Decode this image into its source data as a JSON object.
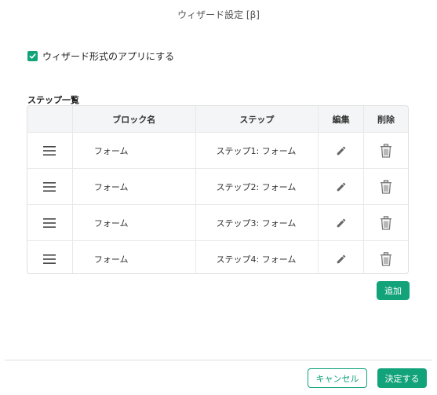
{
  "dialog": {
    "title": "ウィザード設定 [β]"
  },
  "wizard_checkbox": {
    "label": "ウィザード形式のアプリにする",
    "checked": true
  },
  "steps_section": {
    "label": "ステップ一覧",
    "columns": [
      "",
      "ブロック名",
      "ステップ",
      "編集",
      "削除"
    ],
    "rows": [
      {
        "block_name": "フォーム",
        "step": "ステップ1: フォーム"
      },
      {
        "block_name": "フォーム",
        "step": "ステップ2: フォーム"
      },
      {
        "block_name": "フォーム",
        "step": "ステップ3: フォーム"
      },
      {
        "block_name": "フォーム",
        "step": "ステップ4: フォーム"
      }
    ],
    "row_icons": {
      "handle": "drag-handle-icon",
      "edit": "pencil-icon",
      "delete": "trash-icon"
    },
    "add_label": "追加"
  },
  "footer": {
    "cancel_label": "キャンセル",
    "confirm_label": "決定する"
  },
  "colors": {
    "accent": "#12a37a",
    "header_bg": "#f4f5f7",
    "border": "#e0e0e0",
    "icon_gray": "#666666"
  }
}
